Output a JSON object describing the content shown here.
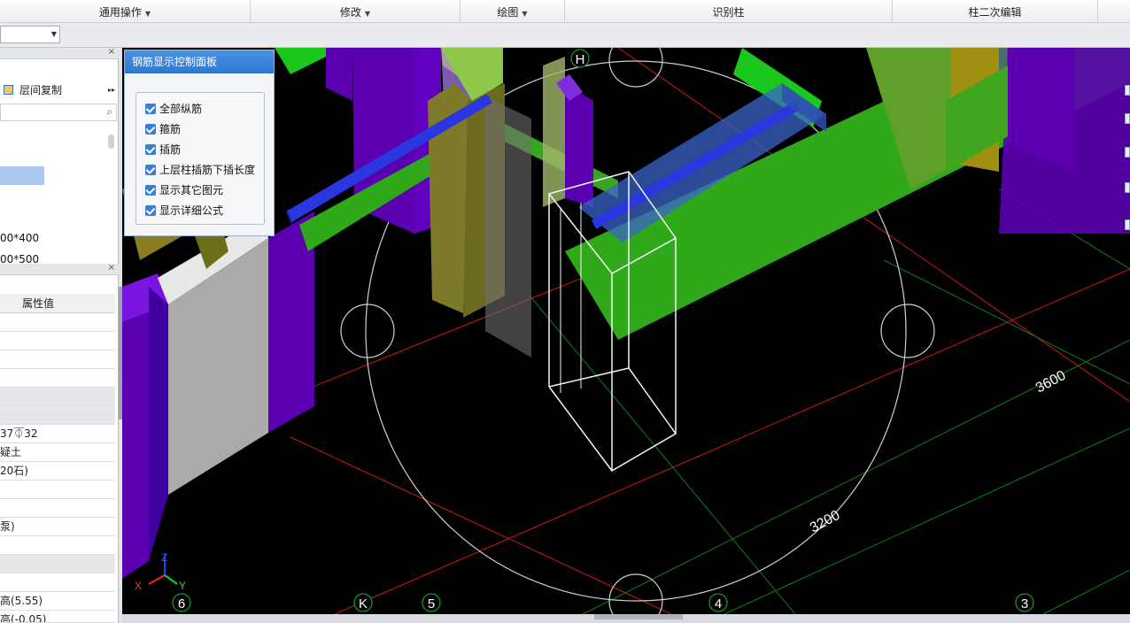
{
  "ribbon": {
    "common_ops": "通用操作",
    "modify": "修改",
    "draw": "绘图",
    "identify_column": "识别柱",
    "column_secondary_edit": "柱二次编辑"
  },
  "left_panel": {
    "floor_copy": "层间复制",
    "tree_items": [
      "00*400",
      "00*500"
    ],
    "prop_header": "属性值",
    "prop_values": [
      "37⏁32",
      "疑土",
      "20石)",
      "泵)",
      "高(5.55)",
      "高(-0.05)"
    ]
  },
  "rebar_panel": {
    "title": "钢筋显示控制面板",
    "options": [
      "全部纵筋",
      "箍筋",
      "插筋",
      "上层柱插筋下插长度",
      "显示其它图元",
      "显示详细公式"
    ]
  },
  "viewport": {
    "axis_labels": {
      "top": "H",
      "bottom": [
        "6",
        "K",
        "5",
        "4",
        "3"
      ]
    },
    "dimensions": [
      "3600",
      "3200"
    ],
    "gizmo": {
      "x": "X",
      "y": "Y",
      "z": "Z"
    }
  },
  "colors": {
    "panel_title": "#2f78d2",
    "checkbox": "#3b7fd4",
    "beam_green": "#2fa81a",
    "column_purple": "#5a00b0",
    "rebar_blue": "#2a36e0",
    "grid_red": "#d01818",
    "grid_green": "#0f7d1b"
  }
}
